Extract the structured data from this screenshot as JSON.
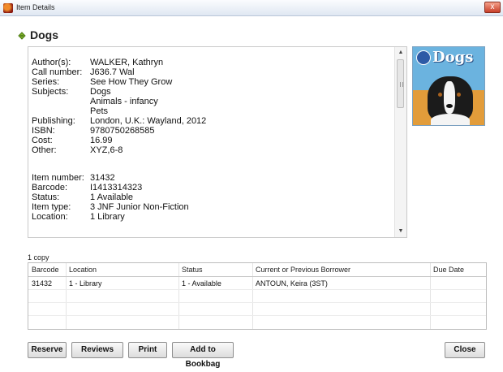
{
  "window": {
    "title": "Item Details",
    "close_glyph": "x"
  },
  "header": {
    "title": "Dogs",
    "icon": "leaf-icon"
  },
  "details": [
    {
      "label": "Author(s):",
      "value": "WALKER, Kathryn"
    },
    {
      "label": "Call number:",
      "value": "J636.7 Wal"
    },
    {
      "label": "Series:",
      "value": "See How They Grow"
    },
    {
      "label": "Subjects:",
      "value": "Dogs"
    },
    {
      "label": "",
      "value": "Animals - infancy"
    },
    {
      "label": "",
      "value": "Pets"
    },
    {
      "label": "Publishing:",
      "value": "London, U.K.: Wayland, 2012"
    },
    {
      "label": "ISBN:",
      "value": "9780750268585"
    },
    {
      "label": "Cost:",
      "value": "16.99"
    },
    {
      "label": "Other:",
      "value": "XYZ,6-8"
    }
  ],
  "item_details": [
    {
      "label": "Item number:",
      "value": "31432"
    },
    {
      "label": "Barcode:",
      "value": "I1413314323"
    },
    {
      "label": "Status:",
      "value": "1  Available"
    },
    {
      "label": "Item type:",
      "value": "3  JNF  Junior Non-Fiction"
    },
    {
      "label": "Location:",
      "value": "1  Library"
    }
  ],
  "cover": {
    "title": "Dogs"
  },
  "copies": {
    "count_label": "1 copy",
    "columns": [
      "Barcode",
      "Location",
      "Status",
      "Current or Previous Borrower",
      "Due Date"
    ],
    "rows": [
      [
        "31432",
        "1 - Library",
        "1 - Available",
        "ANTOUN, Keira (3ST)",
        ""
      ]
    ]
  },
  "buttons": {
    "reserve": "Reserve",
    "reviews": "Reviews",
    "print": "Print",
    "add_to_bookbag": "Add to Bookbag",
    "close": "Close"
  }
}
